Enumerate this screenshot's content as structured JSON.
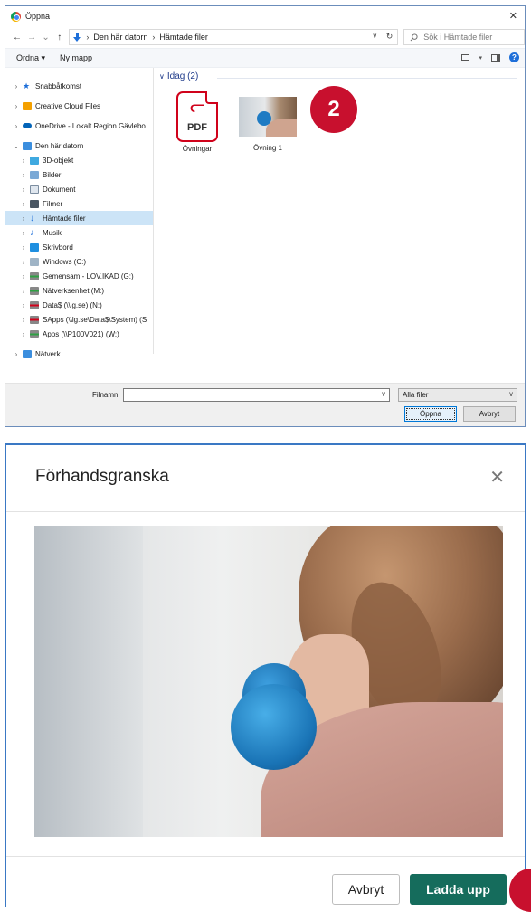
{
  "file_dialog": {
    "title": "Öppna",
    "close": "✕",
    "breadcrumb": [
      "Den här datorn",
      "Hämtade filer"
    ],
    "search_placeholder": "Sök i Hämtade filer",
    "toolbar": {
      "organize": "Ordna ▾",
      "new_folder": "Ny mapp"
    },
    "nav": {
      "quick_access": "Snabbåtkomst",
      "creative_cloud": "Creative Cloud Files",
      "onedrive": "OneDrive - Lokalt Region Gävlebo",
      "this_pc": "Den här datorn",
      "pc_items": [
        "3D-objekt",
        "Bilder",
        "Dokument",
        "Filmer",
        "Hämtade filer",
        "Musik",
        "Skrivbord",
        "Windows (C:)",
        "Gemensam - LOV.IKAD (G:)",
        "Nätverksenhet (M:)",
        "Data$ (\\\\lg.se) (N:)",
        "SApps (\\\\lg.se\\Data$\\System) (S",
        "Apps (\\\\P100V021) (W:)"
      ],
      "network": "Nätverk"
    },
    "group_header": "Idag (2)",
    "files": [
      {
        "name": "Övningar",
        "kind": "pdf",
        "icon_label": "PDF"
      },
      {
        "name": "Övning 1",
        "kind": "image"
      }
    ],
    "step_badge": "2",
    "filename_label": "Filnamn:",
    "filename_value": "",
    "file_type": "Alla filer",
    "open_button": "Öppna",
    "cancel_button": "Avbryt"
  },
  "preview_modal": {
    "title": "Förhandsgranska",
    "close": "✕",
    "cancel_button": "Avbryt",
    "upload_button": "Ladda upp"
  },
  "colors": {
    "badge": "#c8102e",
    "upload_button": "#156c5c",
    "selection": "#cce4f7",
    "accent_blue": "#1e6fd9"
  }
}
